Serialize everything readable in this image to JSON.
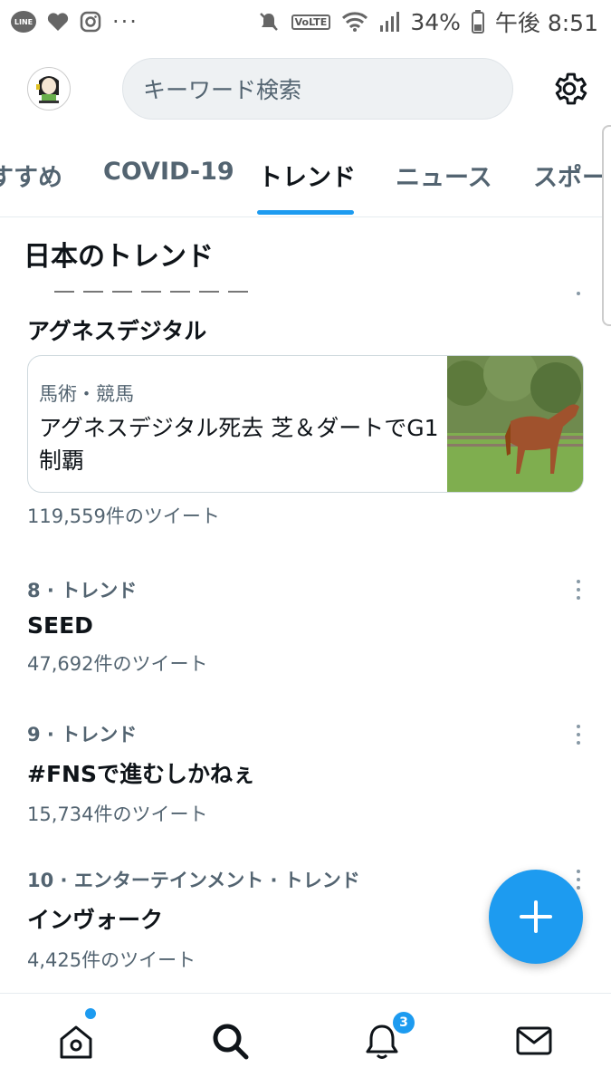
{
  "status_bar": {
    "app_icons": [
      "line-icon",
      "heart-icon",
      "instagram-icon"
    ],
    "more_indicator": "···",
    "battery": "34%",
    "time": "午後 8:51",
    "volte": "VoLTE"
  },
  "header": {
    "search_placeholder": "キーワード検索"
  },
  "tabs": [
    {
      "label": "すすめ"
    },
    {
      "label": "COVID-19"
    },
    {
      "label": "トレンド"
    },
    {
      "label": "ニュース"
    },
    {
      "label": "スポー"
    }
  ],
  "active_tab": "トレンド",
  "section_title": "日本のトレンド",
  "trend_top": {
    "title": "アグネスデジタル",
    "card": {
      "category": "馬術・競馬",
      "headline": "アグネスデジタル死去 芝＆ダートでG1制覇"
    },
    "count": "119,559件のツイート"
  },
  "trends": [
    {
      "meta": "8 · トレンド",
      "title": "SEED",
      "count": "47,692件のツイート"
    },
    {
      "meta": "9 · トレンド",
      "title": "#FNSで進むしかねぇ",
      "count": "15,734件のツイート"
    },
    {
      "meta": "10 · エンターテインメント · トレンド",
      "title": "インヴォーク",
      "count": "4,425件のツイート"
    }
  ],
  "bottom_nav": {
    "notifications_badge": "3",
    "items": [
      "home-icon",
      "search-icon",
      "bell-icon",
      "mail-icon"
    ]
  },
  "colors": {
    "accent": "#1d9bf0",
    "text_primary": "#0f1419",
    "text_secondary": "#536471"
  }
}
